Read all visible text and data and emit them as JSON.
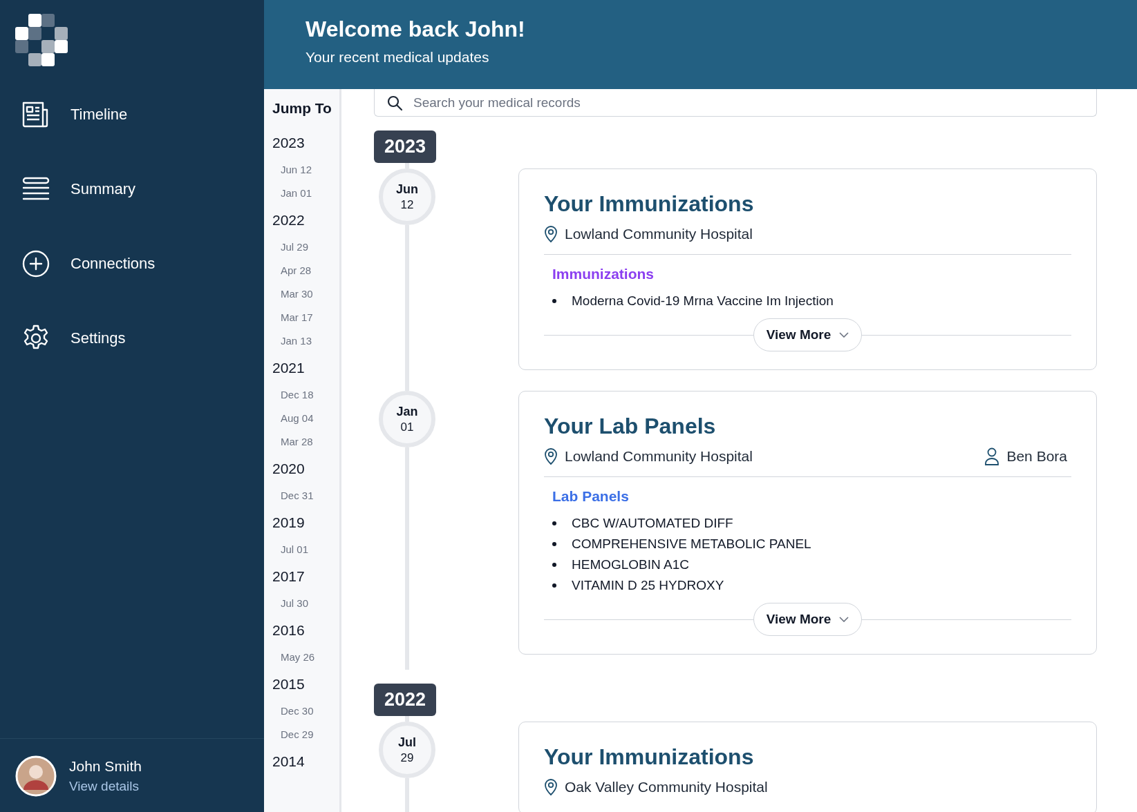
{
  "sidebar": {
    "nav_items": [
      {
        "label": "Timeline",
        "kind": "newspaper"
      },
      {
        "label": "Summary",
        "kind": "lines"
      },
      {
        "label": "Connections",
        "kind": "plus"
      },
      {
        "label": "Settings",
        "kind": "gear"
      }
    ],
    "user": {
      "name": "John Smith",
      "link": "View details"
    }
  },
  "header": {
    "title": "Welcome back John!",
    "subtitle": "Your recent medical updates"
  },
  "search": {
    "placeholder": "Search your medical records"
  },
  "jump_to": {
    "title": "Jump To",
    "years": [
      {
        "year": "2023",
        "dates": [
          "Jun 12",
          "Jan 01"
        ]
      },
      {
        "year": "2022",
        "dates": [
          "Jul 29",
          "Apr 28",
          "Mar 30",
          "Mar 17",
          "Jan 13"
        ]
      },
      {
        "year": "2021",
        "dates": [
          "Dec 18",
          "Aug 04",
          "Mar 28"
        ]
      },
      {
        "year": "2020",
        "dates": [
          "Dec 31"
        ]
      },
      {
        "year": "2019",
        "dates": [
          "Jul 01"
        ]
      },
      {
        "year": "2017",
        "dates": [
          "Jul 30"
        ]
      },
      {
        "year": "2016",
        "dates": [
          "May 26"
        ]
      },
      {
        "year": "2015",
        "dates": [
          "Dec 30",
          "Dec 29"
        ]
      },
      {
        "year": "2014"
      }
    ]
  },
  "timeline": [
    {
      "year": "2023",
      "events": [
        {
          "month": "Jun",
          "day": "12",
          "title": "Your Immunizations",
          "location": "Lowland Community Hospital",
          "category": "Immunizations",
          "color": "#8b3ff0",
          "items": [
            "Moderna Covid-19 Mrna Vaccine Im Injection"
          ],
          "button": "View More"
        },
        {
          "month": "Jan",
          "day": "01",
          "title": "Your Lab Panels",
          "location": "Lowland Community Hospital",
          "provider": "Ben Bora",
          "category": "Lab Panels",
          "color": "#3b6fe6",
          "items": [
            "CBC W/AUTOMATED DIFF",
            "COMPREHENSIVE METABOLIC PANEL",
            "HEMOGLOBIN A1C",
            "VITAMIN D 25 HYDROXY"
          ],
          "button": "View More"
        }
      ]
    },
    {
      "year": "2022",
      "events": [
        {
          "month": "Jul",
          "day": "29",
          "title": "Your Immunizations",
          "location": "Oak Valley Community Hospital"
        }
      ]
    }
  ]
}
